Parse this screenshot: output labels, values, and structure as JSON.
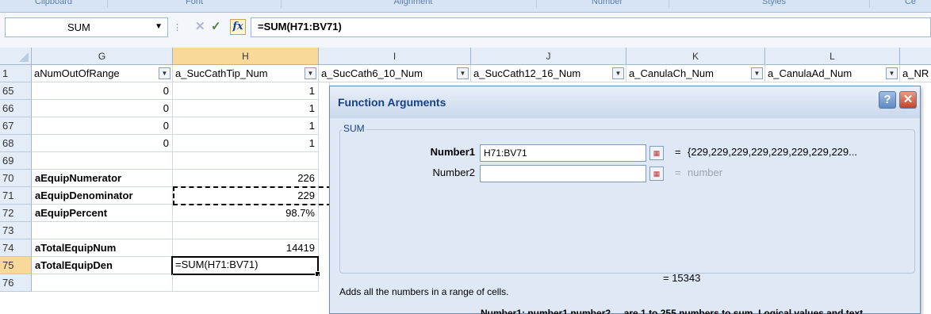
{
  "ribbon": {
    "groups": [
      "Clipboard",
      "Font",
      "Alignment",
      "Number",
      "Styles",
      "Ce"
    ]
  },
  "formula_bar": {
    "name_box": "SUM",
    "formula": "=SUM(H71:BV71)",
    "fx_label": "fx"
  },
  "columns": [
    "G",
    "H",
    "I",
    "J",
    "K",
    "L"
  ],
  "header_row": {
    "row": "1",
    "cells": [
      "aNumOutOfRange",
      "a_SucCathTip_Num",
      "a_SucCath6_10_Num",
      "a_SucCath12_16_Num",
      "a_CanulaCh_Num",
      "a_CanulaAd_Num",
      "a_NR"
    ]
  },
  "rows": [
    {
      "n": "65",
      "g": "0",
      "h": "1"
    },
    {
      "n": "66",
      "g": "0",
      "h": "1"
    },
    {
      "n": "67",
      "g": "0",
      "h": "1"
    },
    {
      "n": "68",
      "g": "0",
      "h": "1"
    },
    {
      "n": "69",
      "g": "",
      "h": ""
    },
    {
      "n": "70",
      "g": "aEquipNumerator",
      "h": "226"
    },
    {
      "n": "71",
      "g": "aEquipDenominator",
      "h": "229"
    },
    {
      "n": "72",
      "g": "aEquipPercent",
      "h": "98.7%"
    },
    {
      "n": "73",
      "g": "",
      "h": ""
    },
    {
      "n": "74",
      "g": "aTotalEquipNum",
      "h": "14419"
    },
    {
      "n": "75",
      "g": "aTotalEquipDen",
      "h": "=SUM(H71:BV71)"
    },
    {
      "n": "76",
      "g": "",
      "h": ""
    }
  ],
  "dialog": {
    "title": "Function Arguments",
    "help": "?",
    "close": "✕",
    "function_name": "SUM",
    "arg1_label": "Number1",
    "arg1_value": "H71:BV71",
    "arg1_result": "{229,229,229,229,229,229,229,229...",
    "arg2_label": "Number2",
    "arg2_value": "",
    "arg2_result": "number",
    "equals": "=",
    "result": "= 15343",
    "description": "Adds all the numbers in a range of cells.",
    "cut_text": "Number1:  number1,number2,... are 1 to 255 numbers to sum. Logical values and text"
  }
}
